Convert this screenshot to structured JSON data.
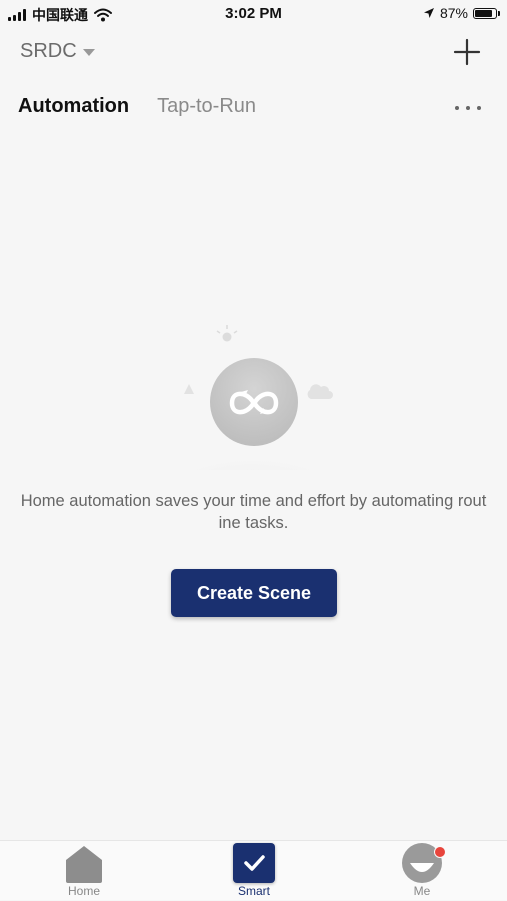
{
  "status_bar": {
    "carrier": "中国联通",
    "time": "3:02 PM",
    "battery_text": "87%",
    "battery_level": 0.87
  },
  "header": {
    "home_name": "SRDC",
    "add_icon": "plus-icon"
  },
  "tabs": [
    {
      "label": "Automation",
      "active": true
    },
    {
      "label": "Tap-to-Run",
      "active": false
    }
  ],
  "more_icon": "more-horizontal-icon",
  "empty_state": {
    "icon": "loop-icon",
    "message": "Home automation saves your time and effort by automating routine tasks.",
    "button_label": "Create Scene"
  },
  "bottom_nav": [
    {
      "label": "Home",
      "icon": "home-icon",
      "active": false
    },
    {
      "label": "Smart",
      "icon": "smart-check-icon",
      "active": true
    },
    {
      "label": "Me",
      "icon": "avatar-icon",
      "active": false,
      "badge": true
    }
  ],
  "colors": {
    "accent": "#1a3070",
    "background": "#f6f6f6",
    "badge": "#e8453c"
  }
}
